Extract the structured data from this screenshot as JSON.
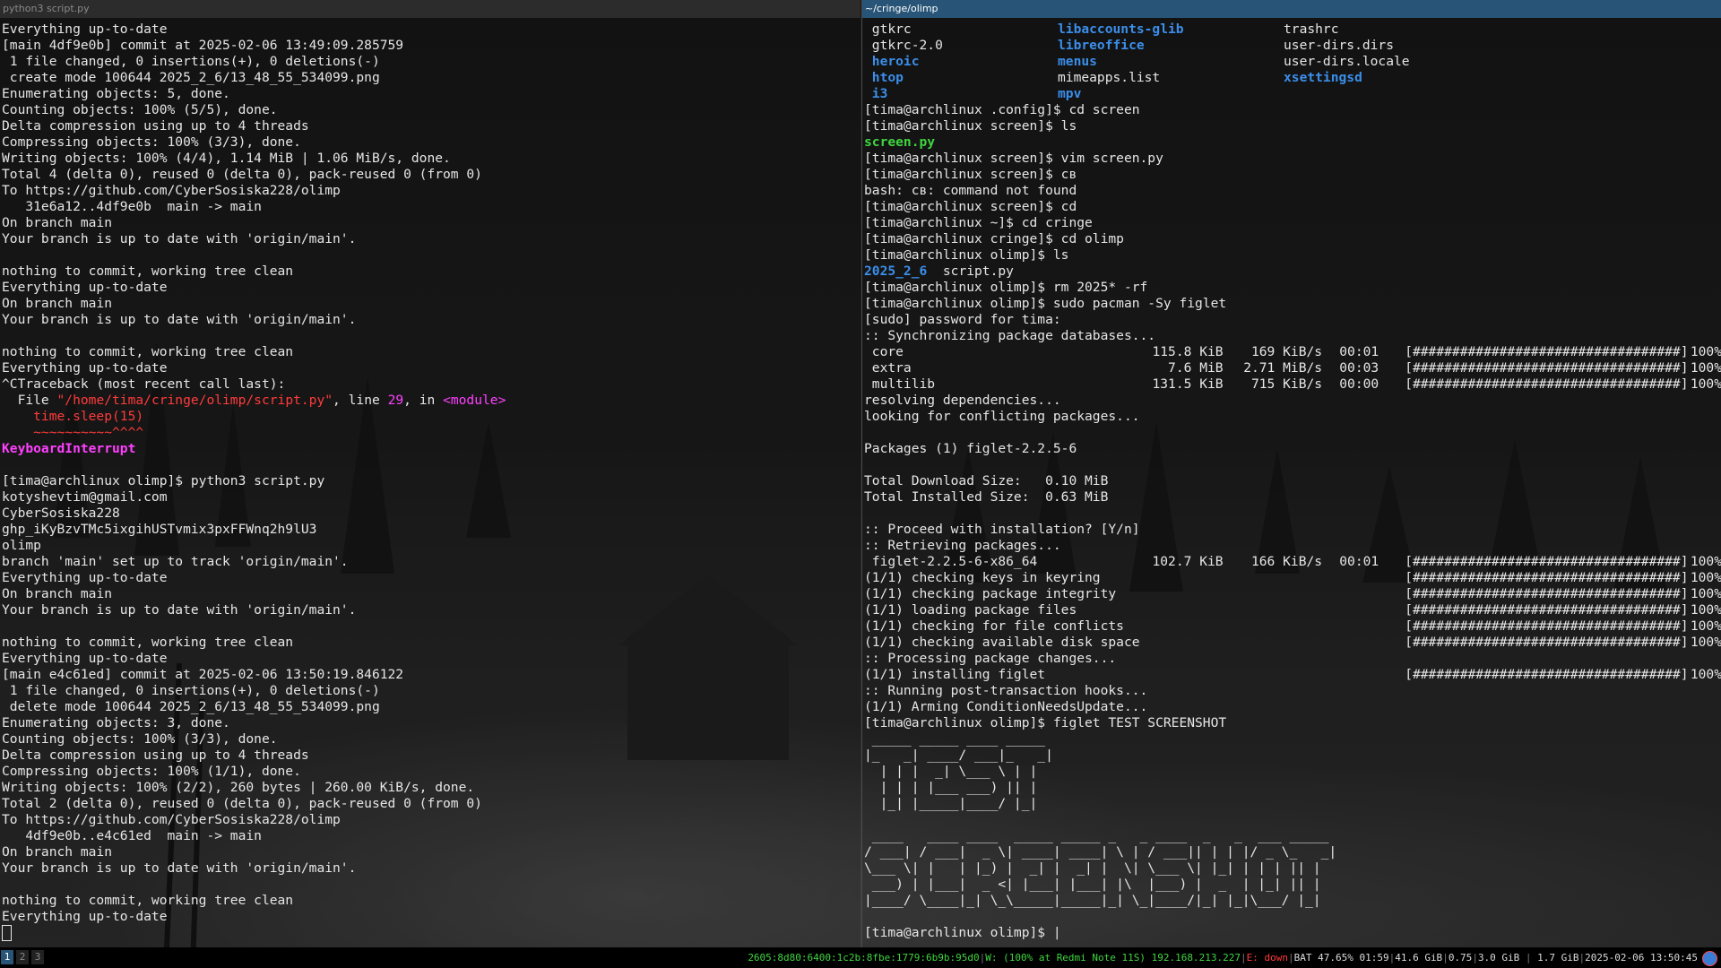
{
  "left": {
    "title": "python3 script.py",
    "lines": [
      [
        "Everything up-to-date"
      ],
      [
        "[main 4df9e0b] commit at 2025-02-06 13:49:09.285759"
      ],
      [
        " 1 file changed, 0 insertions(+), 0 deletions(-)"
      ],
      [
        " create mode 100644 2025_2_6/13_48_55_534099.png"
      ],
      [
        "Enumerating objects: 5, done."
      ],
      [
        "Counting objects: 100% (5/5), done."
      ],
      [
        "Delta compression using up to 4 threads"
      ],
      [
        "Compressing objects: 100% (3/3), done."
      ],
      [
        "Writing objects: 100% (4/4), 1.14 MiB | 1.06 MiB/s, done."
      ],
      [
        "Total 4 (delta 0), reused 0 (delta 0), pack-reused 0 (from 0)"
      ],
      [
        "To https://github.com/CyberSosiska228/olimp"
      ],
      [
        "   31e6a12..4df9e0b  main -> main"
      ],
      [
        "On branch main"
      ],
      [
        "Your branch is up to date with 'origin/main'."
      ],
      [
        ""
      ],
      [
        "nothing to commit, working tree clean"
      ],
      [
        "Everything up-to-date"
      ],
      [
        "On branch main"
      ],
      [
        "Your branch is up to date with 'origin/main'."
      ],
      [
        ""
      ],
      [
        "nothing to commit, working tree clean"
      ],
      [
        "Everything up-to-date"
      ],
      [
        "^CTraceback (most recent call last):"
      ],
      [
        "  File ",
        "\"/home/tima/cringe/olimp/script.py\"",
        ", line ",
        "29",
        ", in ",
        "<module>"
      ],
      [
        "    time.sleep(15)"
      ],
      [
        "    ~~~~~~~~~~^^^^"
      ],
      [
        "KeyboardInterrupt"
      ],
      [
        ""
      ],
      [
        "[tima@archlinux olimp]$ python3 script.py"
      ],
      [
        "kotyshevtim@gmail.com"
      ],
      [
        "CyberSosiska228"
      ],
      [
        "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"
      ],
      [
        "olimp"
      ],
      [
        "branch 'main' set up to track 'origin/main'."
      ],
      [
        "Everything up-to-date"
      ],
      [
        "On branch main"
      ],
      [
        "Your branch is up to date with 'origin/main'."
      ],
      [
        ""
      ],
      [
        "nothing to commit, working tree clean"
      ],
      [
        "Everything up-to-date"
      ],
      [
        "[main e4c61ed] commit at 2025-02-06 13:50:19.846122"
      ],
      [
        " 1 file changed, 0 insertions(+), 0 deletions(-)"
      ],
      [
        " delete mode 100644 2025_2_6/13_48_55_534099.png"
      ],
      [
        "Enumerating objects: 3, done."
      ],
      [
        "Counting objects: 100% (3/3), done."
      ],
      [
        "Delta compression using up to 4 threads"
      ],
      [
        "Compressing objects: 100% (1/1), done."
      ],
      [
        "Writing objects: 100% (2/2), 260 bytes | 260.00 KiB/s, done."
      ],
      [
        "Total 2 (delta 0), reused 0 (delta 0), pack-reused 0 (from 0)"
      ],
      [
        "To https://github.com/CyberSosiska228/olimp"
      ],
      [
        "   4df9e0b..e4c61ed  main -> main"
      ],
      [
        "On branch main"
      ],
      [
        "Your branch is up to date with 'origin/main'."
      ],
      [
        ""
      ],
      [
        "nothing to commit, working tree clean"
      ],
      [
        "Everything up-to-date"
      ]
    ]
  },
  "right": {
    "title": "~/cringe/olimp",
    "ls_config": [
      [
        " gtkrc",
        "libaccounts-glib",
        "trashrc"
      ],
      [
        " gtkrc-2.0",
        "libreoffice",
        "user-dirs.dirs"
      ],
      [
        " heroic",
        "menus",
        "user-dirs.locale"
      ],
      [
        " htop",
        "mimeapps.list",
        "xsettingsd"
      ],
      [
        " i3",
        "mpv",
        ""
      ]
    ],
    "lines_a": [
      "[tima@archlinux .config]$ cd screen",
      "[tima@archlinux screen]$ ls"
    ],
    "ls_screen": "screen.py",
    "lines_b": [
      "[tima@archlinux screen]$ vim screen.py",
      "[tima@archlinux screen]$ cв",
      "bash: cв: command not found",
      "[tima@archlinux screen]$ cd",
      "[tima@archlinux ~]$ cd cringe",
      "[tima@archlinux cringe]$ cd olimp",
      "[tima@archlinux olimp]$ ls"
    ],
    "ls_olimp_dir": "2025_2_6",
    "ls_olimp_file": "  script.py",
    "lines_c": [
      "[tima@archlinux olimp]$ rm 2025* -rf",
      "[tima@archlinux olimp]$ sudo pacman -Sy figlet",
      "[sudo] password for tima:",
      ":: Synchronizing package databases..."
    ],
    "db_rows": [
      {
        "name": " core",
        "size": "115.8 KiB",
        "rate": "169 KiB/s",
        "time": "00:01",
        "bar": "[##################################]",
        "pct": "100%"
      },
      {
        "name": " extra",
        "size": "7.6 MiB",
        "rate": "2.71 MiB/s",
        "time": "00:03",
        "bar": "[##################################]",
        "pct": "100%"
      },
      {
        "name": " multilib",
        "size": "131.5 KiB",
        "rate": "715 KiB/s",
        "time": "00:00",
        "bar": "[##################################]",
        "pct": "100%"
      }
    ],
    "lines_d": [
      "resolving dependencies...",
      "looking for conflicting packages...",
      "",
      "Packages (1) figlet-2.2.5-6",
      "",
      "Total Download Size:   0.10 MiB",
      "Total Installed Size:  0.63 MiB",
      "",
      ":: Proceed with installation? [Y/n]",
      ":: Retrieving packages..."
    ],
    "pkg_rows": [
      {
        "name": " figlet-2.2.5-6-x86_64",
        "size": "102.7 KiB",
        "rate": "166 KiB/s",
        "time": "00:01",
        "bar": "[##################################]",
        "pct": "100%"
      },
      {
        "name": "(1/1) checking keys in keyring",
        "size": "",
        "rate": "",
        "time": "",
        "bar": "[##################################]",
        "pct": "100%"
      },
      {
        "name": "(1/1) checking package integrity",
        "size": "",
        "rate": "",
        "time": "",
        "bar": "[##################################]",
        "pct": "100%"
      },
      {
        "name": "(1/1) loading package files",
        "size": "",
        "rate": "",
        "time": "",
        "bar": "[##################################]",
        "pct": "100%"
      },
      {
        "name": "(1/1) checking for file conflicts",
        "size": "",
        "rate": "",
        "time": "",
        "bar": "[##################################]",
        "pct": "100%"
      },
      {
        "name": "(1/1) checking available disk space",
        "size": "",
        "rate": "",
        "time": "",
        "bar": "[##################################]",
        "pct": "100%"
      }
    ],
    "proc_line": ":: Processing package changes...",
    "install_row": {
      "name": "(1/1) installing figlet",
      "size": "",
      "rate": "",
      "time": "",
      "bar": "[##################################]",
      "pct": "100%"
    },
    "lines_e": [
      ":: Running post-transaction hooks...",
      "(1/1) Arming ConditionNeedsUpdate...",
      "[tima@archlinux olimp]$ figlet TEST SCREENSHOT"
    ],
    "figlet": [
      " _____ _____ ____ _____",
      "|_   _| ____/ ___|_   _|",
      "  | | |  _| \\___ \\ | |",
      "  | | | |___ ___) || |",
      "  |_| |_____|____/ |_|",
      "",
      " ____   ____ ____  _____ _____ _   _ ____  _   _  ___ _____",
      "/ ___| / ___|  _ \\| ____| ____| \\ | / ___|| | | |/ _ \\_   _|",
      "\\___ \\| |   | |_) |  _| |  _| |  \\| \\___ \\| |_| | | | || |",
      " ___) | |___|  _ <| |___| |___| |\\  |___) |  _  | |_| || |",
      "|____/ \\____|_| \\_\\_____|_____|_| \\_|____/|_| |_|\\___/ |_|",
      ""
    ],
    "prompt": "[tima@archlinux olimp]$ "
  },
  "statusbar": {
    "workspaces": [
      "1",
      "2",
      "3"
    ],
    "ipv6": "2605:8d80:6400:1c2b:8fbe:1779:6b9b:95d0",
    "wifi": "W: (100% at Redmi Note 11S) 192.168.213.227",
    "eth": "E: down",
    "battery": "BAT 47.65% 01:59",
    "disk": "41.6 GiB",
    "load": "0.75",
    "mem_used": "3.0 GiB",
    "mem_free": "1.7 GiB",
    "datetime": "2025-02-06 13:50:45"
  },
  "colors": {
    "focused_title": "#285577",
    "prompt_dir_blue": "#3b8eea",
    "exec_green": "#3fd63f",
    "traceback_red": "#ff3b3b",
    "traceback_magenta": "#ff40ff"
  }
}
